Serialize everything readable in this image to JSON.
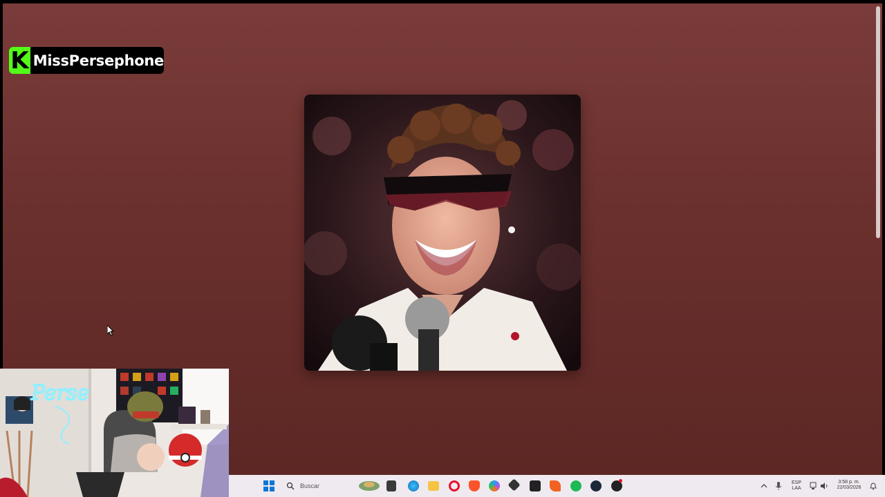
{
  "streamer": {
    "platform_logo": "K",
    "name": "MissPersephone",
    "accent": "#53fc18"
  },
  "album": {
    "icon": "album-cover-photo"
  },
  "webcam": {
    "neon_text": "Perse",
    "neon_color": "#8ff0ff"
  },
  "taskbar": {
    "search_placeholder": "Buscar",
    "lang_line1": "ESP",
    "lang_line2": "LAA",
    "time": "3:58 p. m.",
    "date": "22/03/2026",
    "icons": [
      "windows-start-icon",
      "search-icon",
      "widgets-icon",
      "file-icon",
      "edge-icon",
      "folder-icon",
      "opera-icon",
      "brave-icon",
      "copilot-icon",
      "app-icon",
      "epic-games-icon",
      "brave-alt-icon",
      "spotify-icon",
      "steam-icon",
      "obs-icon"
    ]
  },
  "colors": {
    "background": "#6a302d",
    "taskbar": "#efeaf0"
  }
}
